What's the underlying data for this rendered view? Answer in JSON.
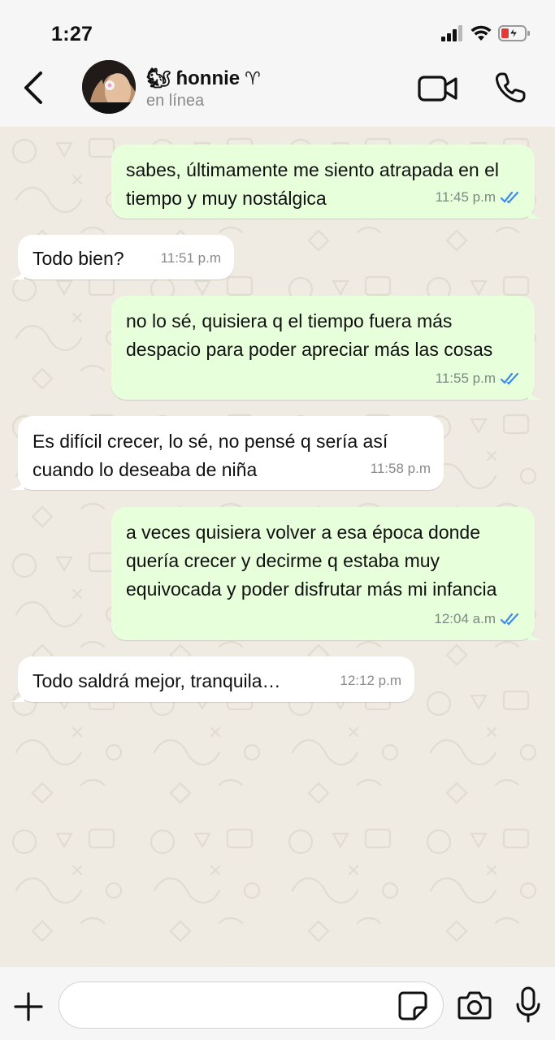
{
  "status_bar": {
    "time": "1:27",
    "icons": [
      "signal-icon",
      "wifi-icon",
      "battery-charging-icon"
    ]
  },
  "header": {
    "back_icon": "chevron-left-icon",
    "contact_emoji": "🐿",
    "contact_name": "ɦonnie",
    "contact_symbol": "♈︎",
    "contact_status": "en línea",
    "video_icon": "video-camera-icon",
    "call_icon": "phone-icon"
  },
  "messages": [
    {
      "direction": "out",
      "text": "sabes, últimamente me siento atrapada en el tiempo y muy nostálgica",
      "time": "11:45 p.m",
      "status": "read"
    },
    {
      "direction": "in",
      "text": "Todo bien?",
      "time": "11:51 p.m"
    },
    {
      "direction": "out",
      "text": "no lo sé, quisiera q el tiempo fuera más despacio para poder apreciar más las cosas",
      "time": "11:55 p.m",
      "status": "read"
    },
    {
      "direction": "in",
      "text": "Es difícil crecer, lo sé, no pensé q sería así cuando lo deseaba de niña",
      "time": "11:58 p.m"
    },
    {
      "direction": "out",
      "text": "a veces quisiera volver a esa época donde quería crecer y decirme q estaba muy equivocada y poder disfrutar más mi infancia",
      "time": "12:04 a.m",
      "status": "read"
    },
    {
      "direction": "in",
      "text": "Todo saldrá mejor, tranquila…",
      "time": "12:12 p.m"
    }
  ],
  "input_bar": {
    "plus_icon": "plus-icon",
    "placeholder": "",
    "sticker_icon": "sticker-icon",
    "camera_icon": "camera-icon",
    "mic_icon": "microphone-icon"
  },
  "colors": {
    "outgoing_bubble": "#e7ffdb",
    "incoming_bubble": "#ffffff",
    "wallpaper": "#efeae2",
    "read_ticks": "#3d8bf0",
    "bars": "#f6f6f6",
    "battery_low": "#e53935"
  }
}
